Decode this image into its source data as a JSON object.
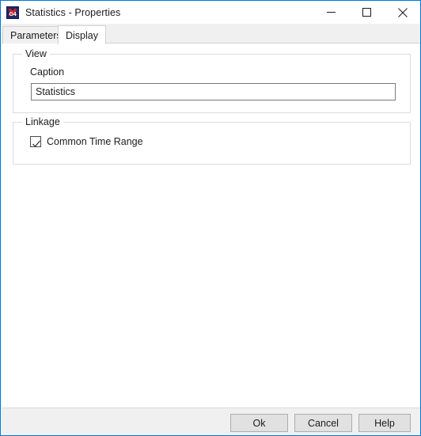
{
  "window": {
    "title": "Statistics - Properties",
    "app_icon": "g4-app-icon",
    "border_color": "#0078d7",
    "controls": [
      {
        "name": "minimize-button",
        "glyph": "minimize-icon"
      },
      {
        "name": "maximize-button",
        "glyph": "maximize-icon"
      },
      {
        "name": "close-button",
        "glyph": "close-icon"
      }
    ]
  },
  "tabs": [
    {
      "label": "Parameters",
      "selected": false
    },
    {
      "label": "Display",
      "selected": true
    }
  ],
  "view_group": {
    "title": "View",
    "caption_label": "Caption",
    "caption_value": "Statistics",
    "caption_placeholder": ""
  },
  "linkage_group": {
    "title": "Linkage",
    "common_time_range_label": "Common Time Range",
    "common_time_range_checked": true
  },
  "footer": {
    "ok_label": "Ok",
    "cancel_label": "Cancel",
    "help_label": "Help"
  }
}
